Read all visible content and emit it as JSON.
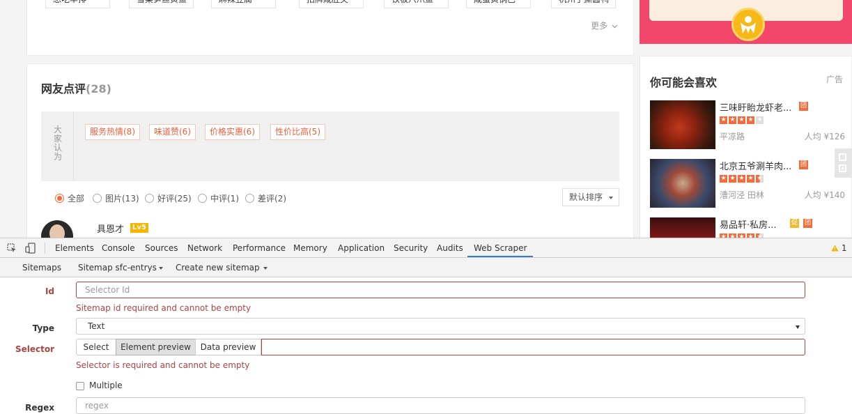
{
  "dishes": [
    "想吃羊排",
    "雪菜笋丝黄鱼",
    "麻辣豆腐",
    "招牌咸肚尖",
    "铁板八爪鱼",
    "咸蛋黄锅巴",
    "杭州手撕酱鸭"
  ],
  "more_label": "更多",
  "reviews": {
    "title": "网友点评",
    "count": "(28)",
    "impression_label": "大家认为",
    "tags": [
      "服务热情(8)",
      "味道赞(6)",
      "价格实惠(6)",
      "性价比高(5)"
    ],
    "filters": [
      "全部",
      "图片(13)",
      "好评(25)",
      "中评(1)",
      "差评(2)"
    ],
    "sort_label": "默认排序",
    "first_reviewer": "具恩才",
    "first_reviewer_level": "Lv5"
  },
  "recommend": {
    "title": "你可能会喜欢",
    "ad_label": "广告",
    "items": [
      {
        "name": "三味盱眙龙虾老...",
        "badges": [
          "团"
        ],
        "stars": 4,
        "location": "平凉路",
        "price": "人均 ¥126"
      },
      {
        "name": "北京五爷涮羊肉...",
        "badges": [
          "团"
        ],
        "stars": 4.5,
        "location": "漕河泾 田林",
        "price": "人均 ¥140"
      },
      {
        "name": "易品轩·私房...",
        "badges": [
          "促",
          "团"
        ],
        "stars": 4.5,
        "location": "",
        "price": ""
      }
    ]
  },
  "devtools": {
    "warning_count": "1",
    "tabs": [
      "Elements",
      "Console",
      "Sources",
      "Network",
      "Performance",
      "Memory",
      "Application",
      "Security",
      "Audits",
      "Web Scraper"
    ],
    "active_tab": "Web Scraper",
    "subnav": {
      "sitemaps": "Sitemaps",
      "sitemap": "Sitemap sfc-entrys",
      "create": "Create new sitemap"
    },
    "form": {
      "id_label": "Id",
      "id_placeholder": "Selector Id",
      "id_error": "Sitemap id required and cannot be empty",
      "type_label": "Type",
      "type_value": "Text",
      "selector_label": "Selector",
      "select_btn": "Select",
      "element_preview_btn": "Element preview",
      "data_preview_btn": "Data preview",
      "selector_error": "Selector is required and cannot be empty",
      "multiple_label": "Multiple",
      "regex_label": "Regex",
      "regex_placeholder": "regex"
    }
  },
  "colors": {
    "accent_orange": "#ff6633",
    "promo_red": "#f2466a",
    "devtools_blue": "#3879d9",
    "error_red": "#a94442"
  }
}
